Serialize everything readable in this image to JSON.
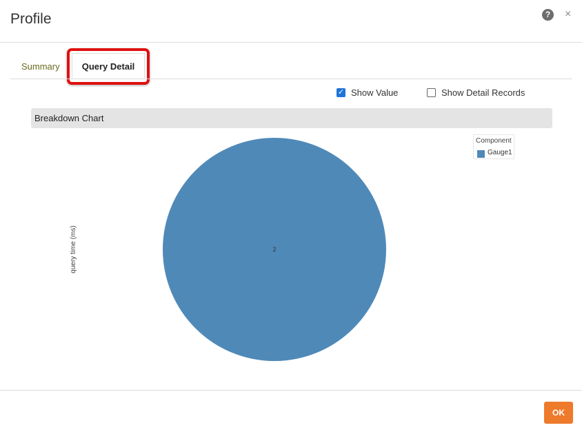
{
  "dialog": {
    "title": "Profile",
    "help_icon_glyph": "?",
    "close_icon_glyph": "×"
  },
  "tabs": [
    {
      "label": "Summary",
      "active": false
    },
    {
      "label": "Query Detail",
      "active": true
    }
  ],
  "options": {
    "show_value": {
      "label": "Show Value",
      "checked": true
    },
    "show_detail_records": {
      "label": "Show Detail Records",
      "checked": false
    }
  },
  "section": {
    "title": "Breakdown Chart"
  },
  "chart_data": {
    "type": "pie",
    "ylabel": "query time (ms)",
    "legend_title": "Component",
    "legend_position": "top-right",
    "slices": [
      {
        "label": "Gauge1",
        "value": 2,
        "color": "#4f89b8"
      }
    ]
  },
  "footer": {
    "ok_label": "OK"
  },
  "colors": {
    "accent_ok": "#ee7a2c",
    "highlight": "#e01010",
    "checkbox": "#1f73d9"
  }
}
